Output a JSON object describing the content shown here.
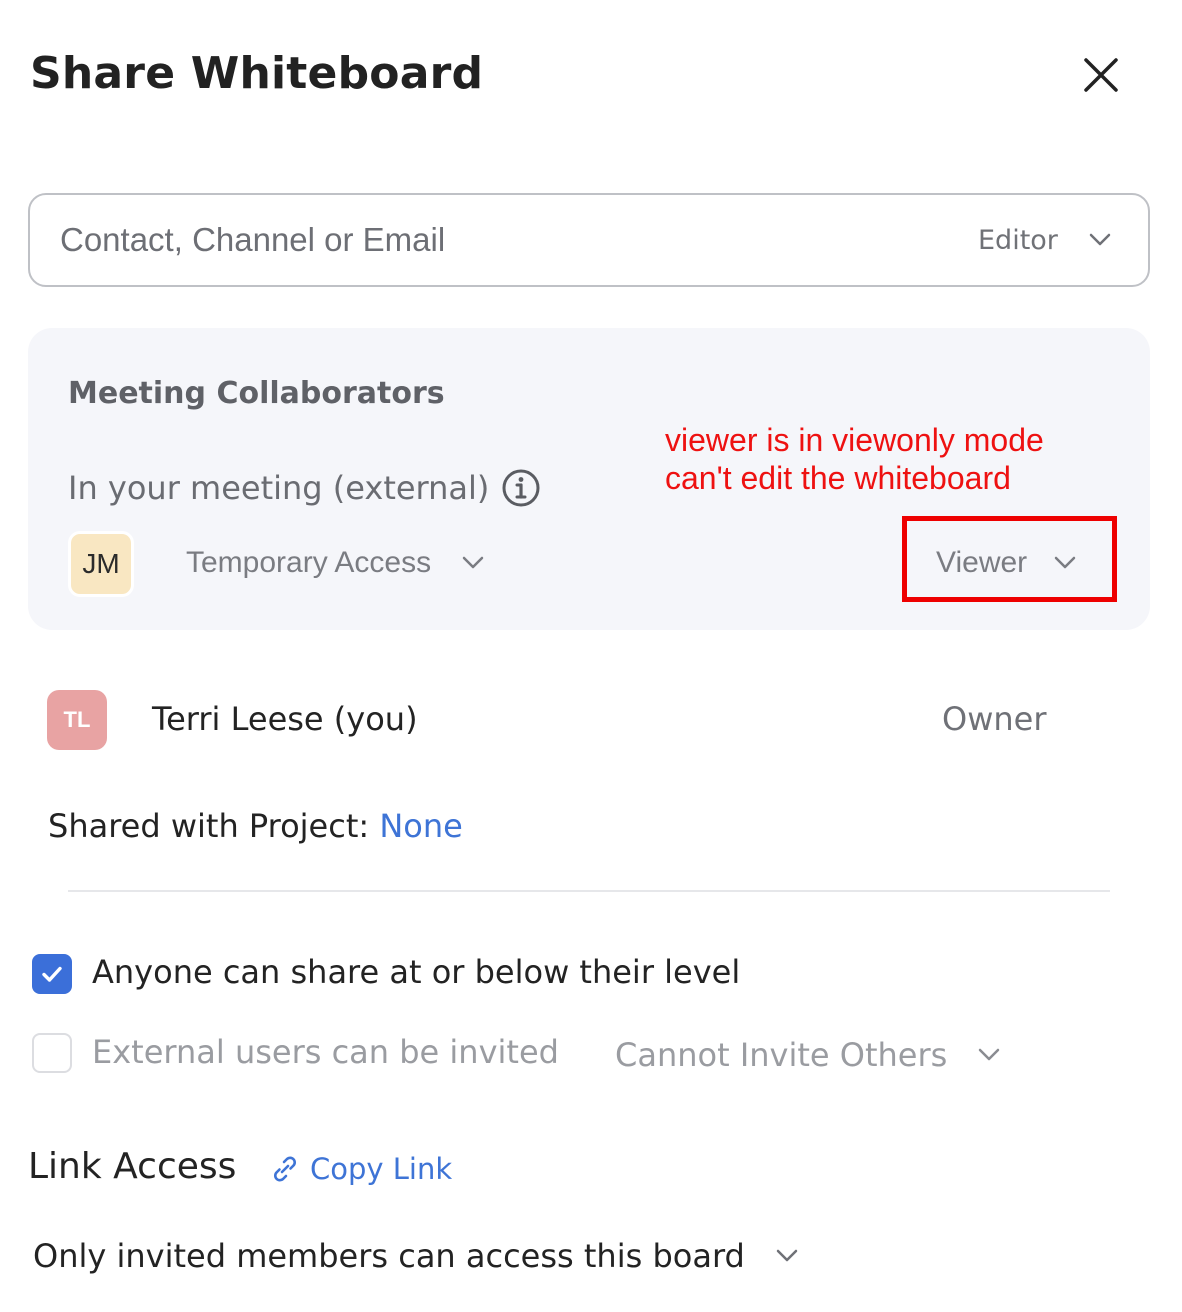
{
  "dialog": {
    "title": "Share Whiteboard"
  },
  "invite": {
    "placeholder": "Contact, Channel or Email",
    "role": "Editor"
  },
  "meeting_collaborators": {
    "heading": "Meeting Collaborators",
    "subheading": "In your meeting (external)",
    "participant": {
      "initials": "JM",
      "access": "Temporary Access",
      "role": "Viewer"
    }
  },
  "annotation": {
    "line1": "viewer is in viewonly mode",
    "line2": "can't edit the whiteboard",
    "color": "#ee0000"
  },
  "owner": {
    "initials": "TL",
    "name": "Terri Leese (you)",
    "role": "Owner"
  },
  "project": {
    "label": "Shared with Project:",
    "value": "None"
  },
  "options": {
    "share_level": {
      "label": "Anyone can share at or below their level",
      "checked": true
    },
    "external_invite": {
      "label": "External users can be invited",
      "checked": false,
      "setting": "Cannot Invite Others"
    }
  },
  "link_access": {
    "heading": "Link Access",
    "copy_label": "Copy Link",
    "access_setting": "Only invited members can access this board"
  },
  "colors": {
    "accent": "#3b6fd9",
    "link": "#3e74d6"
  }
}
